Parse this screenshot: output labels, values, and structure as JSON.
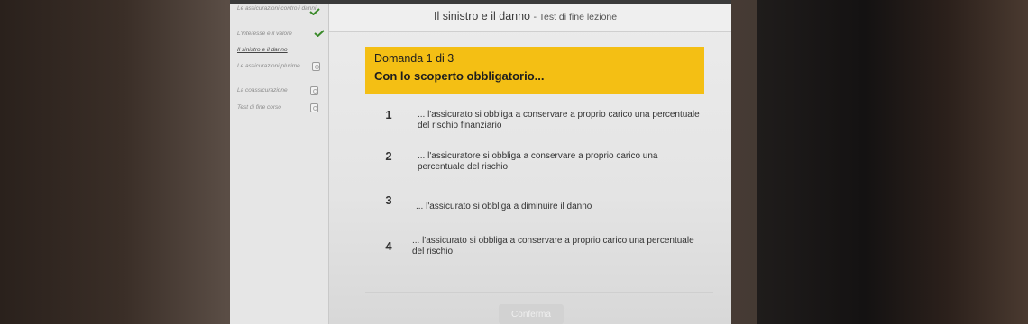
{
  "header": {
    "title": "Il sinistro e il danno",
    "subtitle": "- Test di fine lezione"
  },
  "sidebar": {
    "items": [
      {
        "label": "Le assicurazioni contro i danni",
        "status": "check-icon"
      },
      {
        "label": "L'interesse e il valore",
        "status": "check-icon"
      },
      {
        "label": "Il sinistro e il danno",
        "status": "current"
      },
      {
        "label": "Le assicurazioni plurime",
        "status": "lock-icon"
      },
      {
        "label": "La coassicurazione",
        "status": "lock-icon"
      },
      {
        "label": "Test di fine corso",
        "status": "lock-icon"
      }
    ]
  },
  "question": {
    "counter": "Domanda 1 di 3",
    "text": "Con lo scoperto obbligatorio..."
  },
  "options": [
    {
      "num": "1",
      "text": "... l'assicurato si obbliga a conservare a proprio carico una percentuale del rischio finanziario"
    },
    {
      "num": "2",
      "text": "... l'assicuratore si obbliga a conservare a proprio carico una percentuale del rischio"
    },
    {
      "num": "3",
      "text": "... l'assicurato si obbliga a diminuire il danno"
    },
    {
      "num": "4",
      "text": "... l'assicurato si obbliga a conservare a proprio carico una percentuale del rischio"
    }
  ],
  "confirm_label": "Conferma",
  "colors": {
    "accent": "#f4bf14",
    "check": "#3a8a2a"
  }
}
